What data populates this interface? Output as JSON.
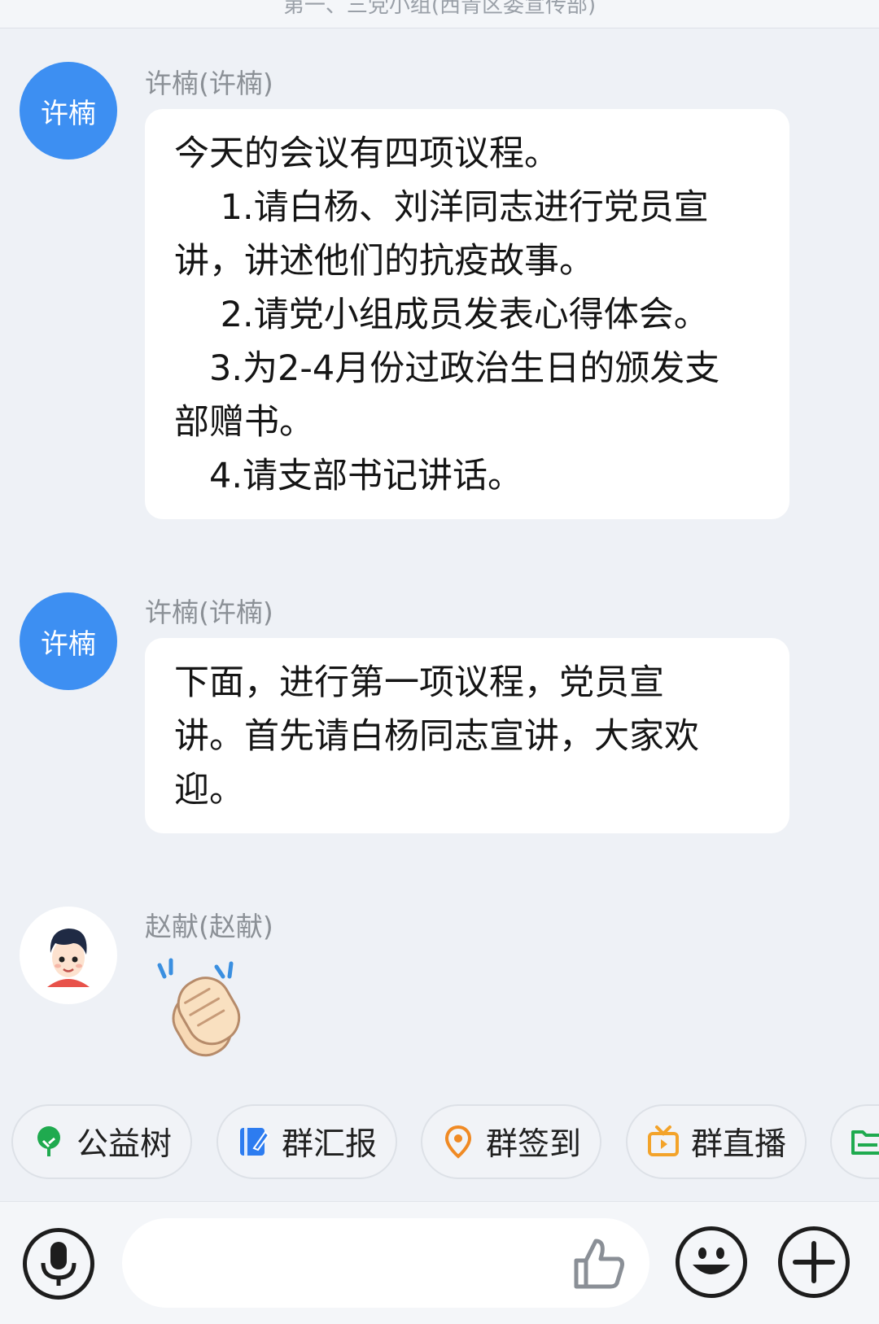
{
  "header": {
    "title": "第一、三党小组(西青区委宣传部)"
  },
  "messages": [
    {
      "avatar_text": "许楠",
      "sender": "许楠(许楠)",
      "lines": [
        "今天的会议有四项议程。",
        "　 1.请白杨、刘洋同志进行党员宣",
        "讲，讲述他们的抗疫故事。",
        "　 2.请党小组成员发表心得体会。",
        "　3.为2-4月份过政治生日的颁发支",
        "部赠书。",
        "　4.请支部书记讲话。"
      ]
    },
    {
      "avatar_text": "许楠",
      "sender": "许楠(许楠)",
      "lines": [
        " 下面，进行第一项议程，党员宣",
        "讲。首先请白杨同志宣讲，大家欢",
        "迎。"
      ]
    },
    {
      "sender": "赵献(赵献)",
      "content": "clapping-hands-emoji"
    }
  ],
  "quick_actions": [
    {
      "label": "公益树",
      "icon": "tree-icon",
      "color": "#1faa4f"
    },
    {
      "label": "群汇报",
      "icon": "report-icon",
      "color": "#2d7cf0"
    },
    {
      "label": "群签到",
      "icon": "location-pin-icon",
      "color": "#f08a24"
    },
    {
      "label": "群直播",
      "icon": "tv-icon",
      "color": "#f3a32a"
    },
    {
      "label": "",
      "icon": "folder-icon",
      "color": "#1faa4f"
    }
  ],
  "input_bar": {
    "placeholder": "",
    "voice_icon": "microphone-icon",
    "like_icon": "thumbs-up-icon",
    "emoji_icon": "smiley-icon",
    "more_icon": "plus-icon"
  },
  "colors": {
    "background": "#eef1f6",
    "avatar_blue": "#3d8ff2",
    "bubble": "#ffffff"
  }
}
